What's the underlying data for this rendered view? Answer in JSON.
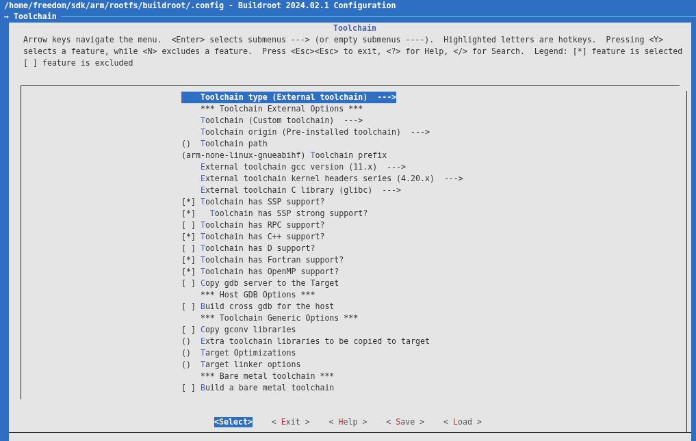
{
  "window": {
    "title": "/home/freedom/sdk/arm/rootfs/buildroot/.config - Buildroot 2024.02.1 Configuration"
  },
  "breadcrumb": {
    "arrow": "→",
    "label": "Toolchain"
  },
  "dialog": {
    "title": "Toolchain",
    "help": [
      "Arrow keys navigate the menu.  <Enter> selects submenus ---> (or empty submenus ----).  Highlighted letters are hotkeys.  Pressing <Y>",
      "selects a feature, while <N> excludes a feature.  Press <Esc><Esc> to exit, <?> for Help, </> for Search.  Legend: [*] feature is selected",
      "[ ] feature is excluded"
    ]
  },
  "menu": [
    {
      "kind": "choice",
      "label": "Toolchain type (External toolchain)  --->",
      "selected": true
    },
    {
      "kind": "comment",
      "label": "*** Toolchain External Options ***",
      "selected": false
    },
    {
      "kind": "choice",
      "label": "Toolchain (Custom toolchain)  --->",
      "selected": false
    },
    {
      "kind": "choice",
      "label": "Toolchain origin (Pre-installed toolchain)  --->",
      "selected": false
    },
    {
      "kind": "option",
      "prefix": "()",
      "label": "Toolchain path",
      "selected": false
    },
    {
      "kind": "option",
      "prefix": "(arm-none-linux-gnueabihf)",
      "label": "Toolchain prefix",
      "selected": false
    },
    {
      "kind": "choice",
      "label": "External toolchain gcc version (11.x)  --->",
      "selected": false
    },
    {
      "kind": "choice",
      "label": "External toolchain kernel headers series (4.20.x)  --->",
      "selected": false
    },
    {
      "kind": "choice",
      "label": "External toolchain C library (glibc)  --->",
      "selected": false
    },
    {
      "kind": "option",
      "prefix": "[*]",
      "label": "Toolchain has SSP support?",
      "selected": false,
      "children": [
        {
          "kind": "option",
          "prefix": "[*]",
          "label": "Toolchain has SSP strong support?",
          "selected": false
        }
      ]
    },
    {
      "kind": "option",
      "prefix": "[ ]",
      "label": "Toolchain has RPC support?",
      "selected": false
    },
    {
      "kind": "option",
      "prefix": "[*]",
      "label": "Toolchain has C++ support?",
      "selected": false
    },
    {
      "kind": "option",
      "prefix": "[ ]",
      "label": "Toolchain has D support?",
      "selected": false
    },
    {
      "kind": "option",
      "prefix": "[*]",
      "label": "Toolchain has Fortran support?",
      "selected": false
    },
    {
      "kind": "option",
      "prefix": "[*]",
      "label": "Toolchain has OpenMP support?",
      "selected": false
    },
    {
      "kind": "option",
      "prefix": "[ ]",
      "label": "Copy gdb server to the Target",
      "selected": false
    },
    {
      "kind": "comment",
      "label": "*** Host GDB Options ***",
      "selected": false
    },
    {
      "kind": "option",
      "prefix": "[ ]",
      "label": "Build cross gdb for the host",
      "selected": false
    },
    {
      "kind": "comment",
      "label": "*** Toolchain Generic Options ***",
      "selected": false
    },
    {
      "kind": "option",
      "prefix": "[ ]",
      "label": "Copy gconv libraries",
      "selected": false
    },
    {
      "kind": "option",
      "prefix": "()",
      "label": "Extra toolchain libraries to be copied to target",
      "selected": false
    },
    {
      "kind": "option",
      "prefix": "()",
      "label": "Target Optimizations",
      "selected": false
    },
    {
      "kind": "option",
      "prefix": "()",
      "label": "Target linker options",
      "selected": false
    },
    {
      "kind": "comment",
      "label": "*** Bare metal toolchain ***",
      "selected": false
    },
    {
      "kind": "option",
      "prefix": "[ ]",
      "label": "Build a bare metal toolchain",
      "selected": false
    }
  ],
  "buttons": [
    {
      "label": "<Select>",
      "selected": true
    },
    {
      "label": "< Exit >",
      "selected": false
    },
    {
      "label": "< Help >",
      "selected": false
    },
    {
      "label": "< Save >",
      "selected": false
    },
    {
      "label": "< Load >",
      "selected": false
    }
  ]
}
